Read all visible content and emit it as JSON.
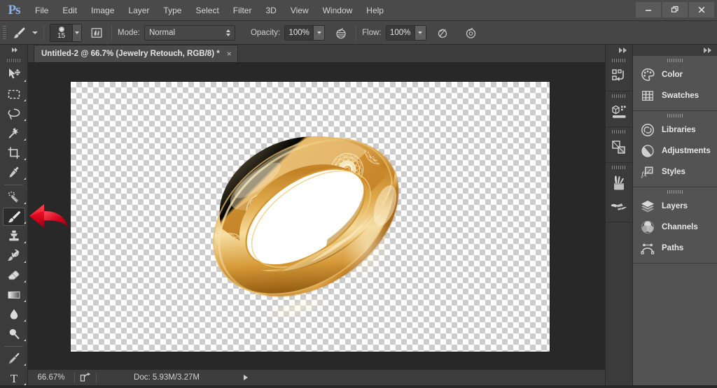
{
  "app": {
    "name": "Adobe Photoshop",
    "logo_text": "Ps",
    "logo_color": "#8ab4e8"
  },
  "menubar": {
    "items": [
      {
        "label": "File"
      },
      {
        "label": "Edit"
      },
      {
        "label": "Image"
      },
      {
        "label": "Layer"
      },
      {
        "label": "Type"
      },
      {
        "label": "Select"
      },
      {
        "label": "Filter"
      },
      {
        "label": "3D"
      },
      {
        "label": "View"
      },
      {
        "label": "Window"
      },
      {
        "label": "Help"
      }
    ],
    "window_controls": {
      "minimize": "minimize-icon",
      "restore": "restore-icon",
      "close": "close-icon"
    }
  },
  "options_bar": {
    "tool_icon": "brush-tool-icon",
    "brush_size": "15",
    "brush_panel_icon": "brush-panel-icon",
    "mode_label": "Mode:",
    "mode_value": "Normal",
    "opacity_label": "Opacity:",
    "opacity_value": "100%",
    "airbrush_pressure_icon": "tablet-pressure-opacity-icon",
    "flow_label": "Flow:",
    "flow_value": "100%",
    "flow_pressure_icon": "tablet-pressure-size-icon",
    "airbrush_icon": "airbrush-icon"
  },
  "document_tab": {
    "title": "Untitled-2 @ 66.7% (Jewelry Retouch, RGB/8) *",
    "close": "×"
  },
  "toolbar": {
    "collapse_icon": "expand-toolbar-icon",
    "tools": [
      {
        "name": "move-tool",
        "icon": "move-tool-icon",
        "selected": false,
        "has_flyout": true
      },
      {
        "name": "rectangular-marquee-tool",
        "icon": "marquee-tool-icon",
        "selected": false,
        "has_flyout": true
      },
      {
        "name": "lasso-tool",
        "icon": "lasso-tool-icon",
        "selected": false,
        "has_flyout": true
      },
      {
        "name": "magic-wand-tool",
        "icon": "magic-wand-tool-icon",
        "selected": false,
        "has_flyout": true
      },
      {
        "name": "crop-tool",
        "icon": "crop-tool-icon",
        "selected": false,
        "has_flyout": true
      },
      {
        "name": "eyedropper-tool",
        "icon": "eyedropper-tool-icon",
        "selected": false,
        "has_flyout": true
      },
      {
        "name": "spot-healing-brush-tool",
        "icon": "healing-brush-tool-icon",
        "selected": false,
        "has_flyout": true,
        "divider_before": true
      },
      {
        "name": "brush-tool",
        "icon": "brush-tool-icon",
        "selected": true,
        "has_flyout": true
      },
      {
        "name": "clone-stamp-tool",
        "icon": "clone-stamp-tool-icon",
        "selected": false,
        "has_flyout": true
      },
      {
        "name": "history-brush-tool",
        "icon": "history-brush-tool-icon",
        "selected": false,
        "has_flyout": true
      },
      {
        "name": "eraser-tool",
        "icon": "eraser-tool-icon",
        "selected": false,
        "has_flyout": true
      },
      {
        "name": "gradient-tool",
        "icon": "gradient-tool-icon",
        "selected": false,
        "has_flyout": true
      },
      {
        "name": "blur-tool",
        "icon": "blur-droplet-tool-icon",
        "selected": false,
        "has_flyout": true
      },
      {
        "name": "dodge-tool",
        "icon": "dodge-tool-icon",
        "selected": false,
        "has_flyout": true
      },
      {
        "name": "pen-tool",
        "icon": "pen-tool-icon",
        "selected": false,
        "has_flyout": true,
        "divider_before": true
      },
      {
        "name": "type-tool",
        "icon": "type-tool-icon",
        "selected": false,
        "has_flyout": true
      }
    ]
  },
  "canvas": {
    "artwork_name": "gold-ring-with-floral-engraving",
    "background": "transparency-checkerboard",
    "zoom_percent": "66.67%"
  },
  "statusbar": {
    "zoom": "66.67%",
    "share_icon": "share-on-behance-icon",
    "doc_info": "Doc: 5.93M/3.27M",
    "expand_icon": "status-expand-arrow-icon"
  },
  "dock_icons": {
    "collapse_icon": "collapse-panels-icon",
    "groups": [
      {
        "items": [
          {
            "name": "history-panel-icon",
            "label": "History"
          }
        ]
      },
      {
        "items": [
          {
            "name": "properties-panel-icon",
            "label": "Properties"
          }
        ]
      },
      {
        "items": [
          {
            "name": "layer-comps-panel-icon",
            "label": "Layer Comps"
          }
        ]
      },
      {
        "items": [
          {
            "name": "brush-presets-panel-icon",
            "label": "Brush Presets"
          },
          {
            "name": "brush-panel-icon",
            "label": "Brush"
          }
        ]
      }
    ]
  },
  "dock_panels": {
    "collapse_icon": "collapse-panels-icon",
    "groups": [
      {
        "items": [
          {
            "label": "Color",
            "icon": "color-palette-icon"
          },
          {
            "label": "Swatches",
            "icon": "swatches-grid-icon"
          }
        ]
      },
      {
        "items": [
          {
            "label": "Libraries",
            "icon": "libraries-cc-icon"
          },
          {
            "label": "Adjustments",
            "icon": "adjustments-halfcircle-icon"
          },
          {
            "label": "Styles",
            "icon": "styles-fx-icon"
          }
        ]
      },
      {
        "items": [
          {
            "label": "Layers",
            "icon": "layers-stack-icon"
          },
          {
            "label": "Channels",
            "icon": "channels-venn-icon"
          },
          {
            "label": "Paths",
            "icon": "paths-bezier-icon"
          }
        ]
      }
    ]
  },
  "annotation": {
    "name": "red-pointer-arrow",
    "direction": "left",
    "points_at": "brush-tool",
    "color": "#e8112d"
  },
  "colors": {
    "menubar_bg": "#4a4a4a",
    "options_bg": "#464646",
    "panel_bg": "#535353",
    "toolbar_bg": "#3b3b3b",
    "canvas_bg": "#282828",
    "accent": "#8ab4e8"
  }
}
